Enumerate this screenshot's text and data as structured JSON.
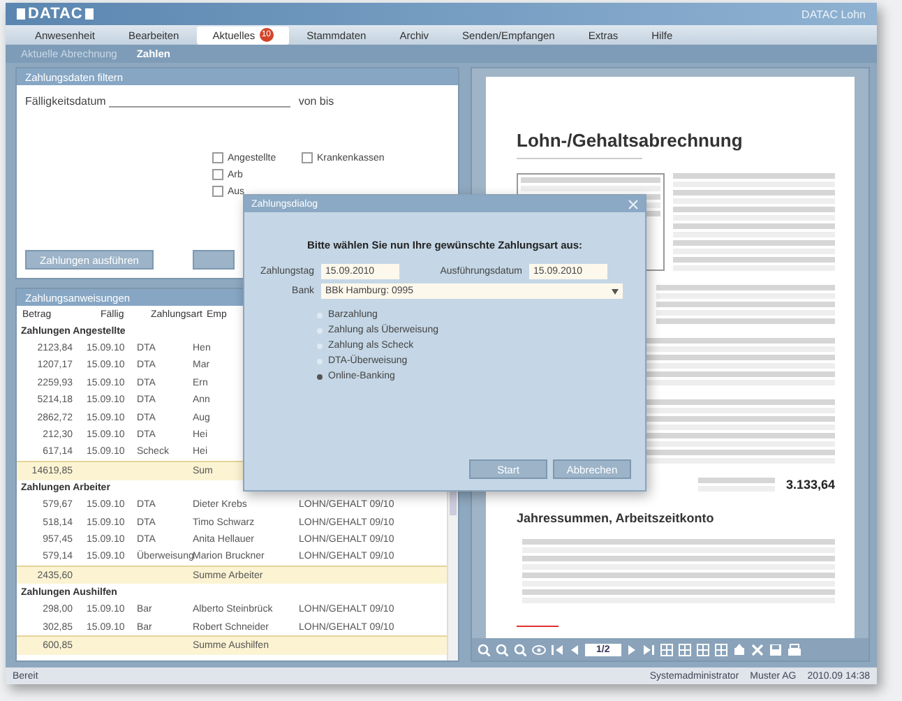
{
  "header": {
    "logo": "DATAC",
    "product": "DATAC Lohn"
  },
  "menu": [
    {
      "label": "Anwesenheit",
      "selected": false
    },
    {
      "label": "Bearbeiten",
      "selected": false
    },
    {
      "label": "Aktuelles",
      "selected": true,
      "badge": "10"
    },
    {
      "label": "Stammdaten",
      "selected": false
    },
    {
      "label": "Archiv",
      "selected": false
    },
    {
      "label": "Senden/Empfangen",
      "selected": false
    },
    {
      "label": "Extras",
      "selected": false
    },
    {
      "label": "Hilfe",
      "selected": false
    }
  ],
  "subtabs": [
    {
      "label": "Aktuelle Abrechnung",
      "selected": false
    },
    {
      "label": "Zahlen",
      "selected": true
    }
  ],
  "filter": {
    "title": "Zahlungsdaten filtern",
    "date_label": "Fälligkeitsdatum",
    "range_label": "von bis",
    "checkboxes": [
      {
        "label": "Angestellte",
        "checked": false
      },
      {
        "label": "Arb",
        "checked": false
      },
      {
        "label": "Aus",
        "checked": false
      },
      {
        "label": "Krankenkassen",
        "checked": false
      }
    ],
    "button": "Zahlungen ausführen"
  },
  "payments": {
    "title": "Zahlungsanweisungen",
    "columns": [
      "Betrag",
      "Fällig",
      "Zahlungsart",
      "Emp"
    ],
    "groups": [
      {
        "title": "Zahlungen Angestellte",
        "rows": [
          [
            "2123,84",
            "15.09.10",
            "DTA",
            "Hen",
            ""
          ],
          [
            "1207,17",
            "15.09.10",
            "DTA",
            "Mar",
            ""
          ],
          [
            "2259,93",
            "15.09.10",
            "DTA",
            "Ern",
            ""
          ],
          [
            "5214,18",
            "15.09.10",
            "DTA",
            "Ann",
            ""
          ],
          [
            "2862,72",
            "15.09.10",
            "DTA",
            "Aug",
            ""
          ],
          [
            "212,30",
            "15.09.10",
            "DTA",
            "Hei",
            ""
          ],
          [
            "617,14",
            "15.09.10",
            "Scheck",
            "Hei",
            ""
          ]
        ],
        "sum": [
          "14619,85",
          "Sum"
        ]
      },
      {
        "title": "Zahlungen Arbeiter",
        "rows": [
          [
            "579,67",
            "15.09.10",
            "DTA",
            "Dieter Krebs",
            "LOHN/GEHALT 09/10"
          ],
          [
            "518,14",
            "15.09.10",
            "DTA",
            "Timo Schwarz",
            "LOHN/GEHALT 09/10"
          ],
          [
            "957,45",
            "15.09.10",
            "DTA",
            "Anita Hellauer",
            "LOHN/GEHALT 09/10"
          ],
          [
            "579,14",
            "15.09.10",
            "Überweisung",
            "Marion Bruckner",
            "LOHN/GEHALT 09/10"
          ]
        ],
        "sum": [
          "2435,60",
          "Summe Arbeiter"
        ]
      },
      {
        "title": "Zahlungen Aushilfen",
        "rows": [
          [
            "298,00",
            "15.09.10",
            "Bar",
            "Alberto Steinbrück",
            "LOHN/GEHALT 09/10"
          ],
          [
            "302,85",
            "15.09.10",
            "Bar",
            "Robert Schneider",
            "LOHN/GEHALT 09/10"
          ]
        ],
        "sum": [
          "600,85",
          "Summe Aushilfen"
        ]
      }
    ]
  },
  "dialog": {
    "title": "Zahlungsdialog",
    "prompt": "Bitte wählen Sie nun Ihre gewünschte Zahlungsart aus:",
    "payment_day_label": "Zahlungstag",
    "payment_day": "15.09.2010",
    "execution_label": "Ausführungsdatum",
    "execution_date": "15.09.2010",
    "bank_label": "Bank",
    "bank": "BBk Hamburg: 0995",
    "options": [
      {
        "label": "Barzahlung",
        "selected": false
      },
      {
        "label": "Zahlung als Überweisung",
        "selected": false
      },
      {
        "label": "Zahlung als Scheck",
        "selected": false
      },
      {
        "label": "DTA-Überweisung",
        "selected": false
      },
      {
        "label": "Online-Banking",
        "selected": true
      }
    ],
    "buttons": [
      "Start",
      "Abbrechen"
    ]
  },
  "document": {
    "title": "Lohn-/Gehaltsabrechnung",
    "section_title": "Jahressummen, Arbeitszeitkonto",
    "total": "3.133,64",
    "page": "1/2"
  },
  "status_bar": {
    "left": "Bereit",
    "right": [
      "Systemadministrator",
      "Muster AG",
      "2010.09 14:38"
    ]
  }
}
